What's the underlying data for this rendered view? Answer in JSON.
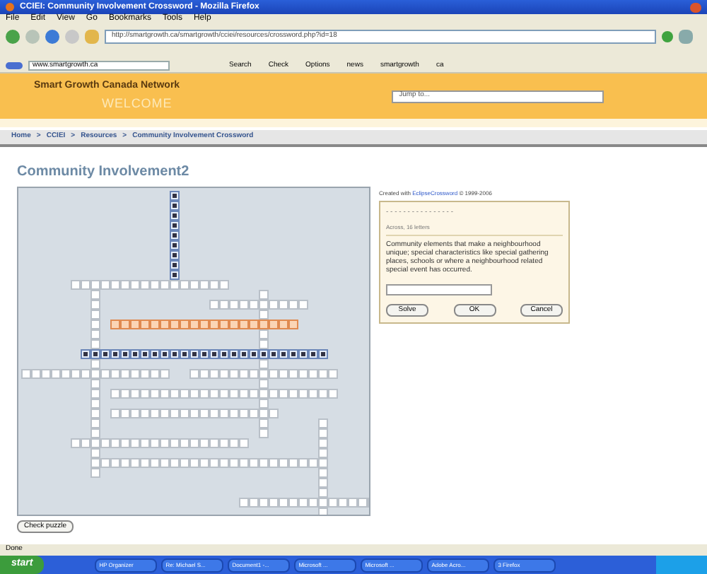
{
  "window": {
    "title": "CCIEI: Community Involvement Crossword - Mozilla Firefox"
  },
  "menu": [
    "File",
    "Edit",
    "View",
    "Go",
    "Bookmarks",
    "Tools",
    "Help"
  ],
  "address": {
    "value": "http://smartgrowth.ca/smartgrowth/cciei/resources/crossword.php?id=18"
  },
  "google_bar": {
    "search_value": "www.smartgrowth.ca",
    "items": [
      "Search",
      "Check",
      "Options",
      "news",
      "smartgrowth",
      "ca"
    ]
  },
  "site_header": {
    "name": "Smart Growth Canada Network",
    "welcome": "WELCOME",
    "jump": {
      "placeholder": "Jump to..."
    }
  },
  "breadcrumb": [
    "Home",
    "CCIEI",
    "Resources",
    "Community Involvement Crossword"
  ],
  "breadcrumb_separator": ">",
  "heading": "Community Involvement2",
  "crossword": {
    "words": [
      {
        "filled": true,
        "selected": false
      },
      {
        "filled": false,
        "selected": false
      },
      {
        "filled": false,
        "selected": false
      },
      {
        "filled": false,
        "selected": false
      },
      {
        "filled": false,
        "selected": false
      },
      {
        "filled": false,
        "selected": true
      },
      {
        "filled": true,
        "selected": false
      },
      {
        "filled": false,
        "selected": false
      },
      {
        "filled": false,
        "selected": false
      },
      {
        "filled": false,
        "selected": false
      },
      {
        "filled": false,
        "selected": false
      },
      {
        "filled": false,
        "selected": false
      },
      {
        "filled": false,
        "selected": false
      },
      {
        "filled": false,
        "selected": false
      },
      {
        "filled": false,
        "selected": false
      }
    ]
  },
  "credit": {
    "text": "Created with",
    "link": "EclipseCrossword",
    "rest": "© 1999-2006"
  },
  "clue_box": {
    "pattern": "- - - - - - - - - - - - - - - -",
    "heading": "Across, 16 letters",
    "clue": "Community elements that make a neighbourhood unique; special characteristics like special gathering places, schools or where a neighbourhood related special event has occurred.",
    "buttons": [
      "Solve",
      "OK",
      "Cancel"
    ]
  },
  "check_button": "Check puzzle",
  "status_bar": "Done",
  "taskbar": {
    "start": "start",
    "items": [
      "HP Organizer",
      "Re: Michael S...",
      "Document1 -...",
      "Microsoft ...",
      "Microsoft ...",
      "Adobe Acro...",
      "3 Firefox"
    ]
  }
}
